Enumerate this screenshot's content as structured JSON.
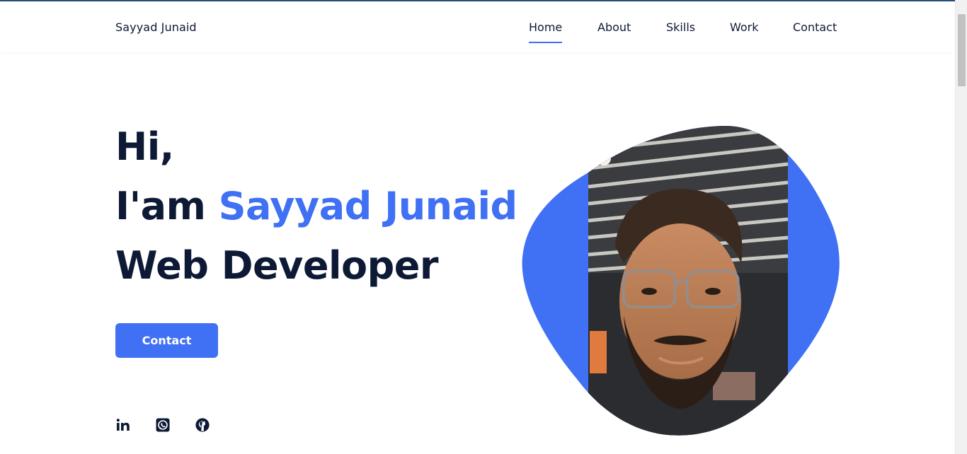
{
  "brand": {
    "name": "Sayyad Junaid",
    "accent_color": "#4070f4",
    "text_color": "#0e1a35"
  },
  "nav": {
    "items": [
      {
        "label": "Home",
        "active": true
      },
      {
        "label": "About",
        "active": false
      },
      {
        "label": "Skills",
        "active": false
      },
      {
        "label": "Work",
        "active": false
      },
      {
        "label": "Contact",
        "active": false
      }
    ]
  },
  "hero": {
    "greeting": "Hi,",
    "intro_prefix": "I'am ",
    "intro_name": "Sayyad Junaid",
    "role": "Web Developer",
    "cta_label": "Contact"
  },
  "social": [
    {
      "icon": "linkedin-icon"
    },
    {
      "icon": "whatsapp-icon"
    },
    {
      "icon": "github-icon"
    }
  ],
  "avatar": {
    "icon": "profile-photo",
    "blob_color": "#4070f4"
  }
}
